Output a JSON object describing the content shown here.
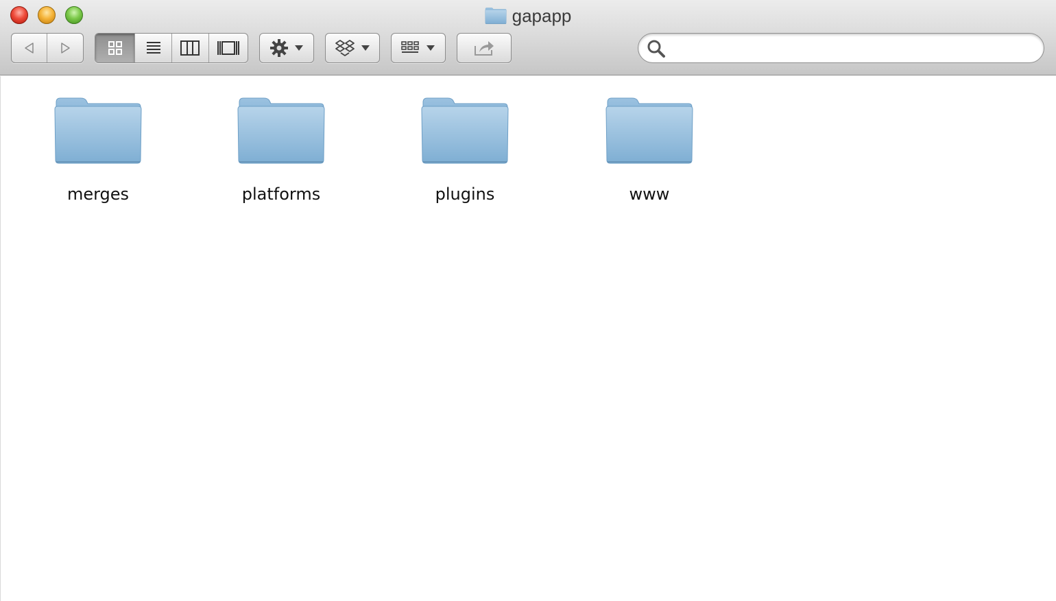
{
  "window": {
    "title": "gapapp",
    "title_icon": "folder-icon"
  },
  "toolbar": {
    "nav": [
      "back-arrow-icon",
      "forward-arrow-icon"
    ],
    "view_modes": [
      "icon-view-icon",
      "list-view-icon",
      "column-view-icon",
      "coverflow-view-icon"
    ],
    "active_view": "icon",
    "action_menu": "gear-icon",
    "dropbox_menu": "dropbox-icon",
    "arrange_menu": "arrange-grid-icon",
    "share": "share-icon"
  },
  "search": {
    "placeholder": "",
    "value": ""
  },
  "items": [
    {
      "name": "merges",
      "kind": "folder"
    },
    {
      "name": "platforms",
      "kind": "folder"
    },
    {
      "name": "plugins",
      "kind": "folder"
    },
    {
      "name": "www",
      "kind": "folder"
    }
  ],
  "colors": {
    "folder_top": "#a9cbe4",
    "folder_bottom": "#7faed2",
    "titlebar_top": "#ececec",
    "titlebar_bottom": "#c6c6c6"
  }
}
